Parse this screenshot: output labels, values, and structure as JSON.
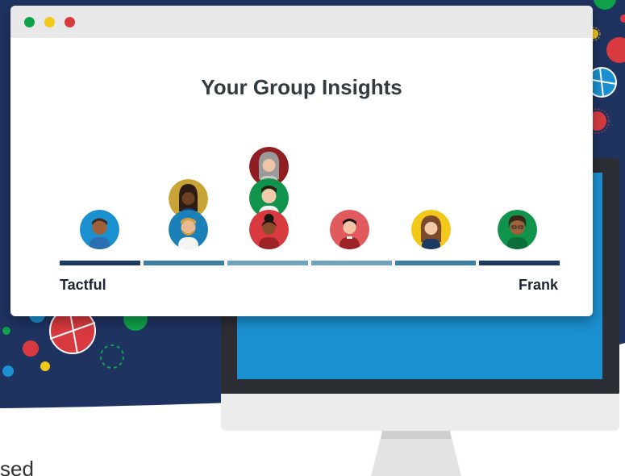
{
  "window": {
    "title": "Your Group Insights",
    "left_label": "Tactful",
    "right_label": "Frank"
  },
  "colors": {
    "background_navy": "#1f3361",
    "scale_dark": "#1d3a63",
    "scale_mid": "#3b7fa3",
    "scale_light": "#6fa3bd",
    "monitor_screen": "#1b90d1"
  },
  "members": [
    {
      "name": "member-1",
      "column": 1,
      "level": 1
    },
    {
      "name": "member-2",
      "column": 2,
      "level": 1
    },
    {
      "name": "member-3",
      "column": 2,
      "level": 2
    },
    {
      "name": "member-4",
      "column": 3,
      "level": 1
    },
    {
      "name": "member-5",
      "column": 3,
      "level": 2
    },
    {
      "name": "member-6",
      "column": 3,
      "level": 3
    },
    {
      "name": "member-7",
      "column": 4,
      "level": 1
    },
    {
      "name": "member-8",
      "column": 5,
      "level": 1
    },
    {
      "name": "member-9",
      "column": 6,
      "level": 1
    }
  ],
  "footer_partial_text": "sed"
}
